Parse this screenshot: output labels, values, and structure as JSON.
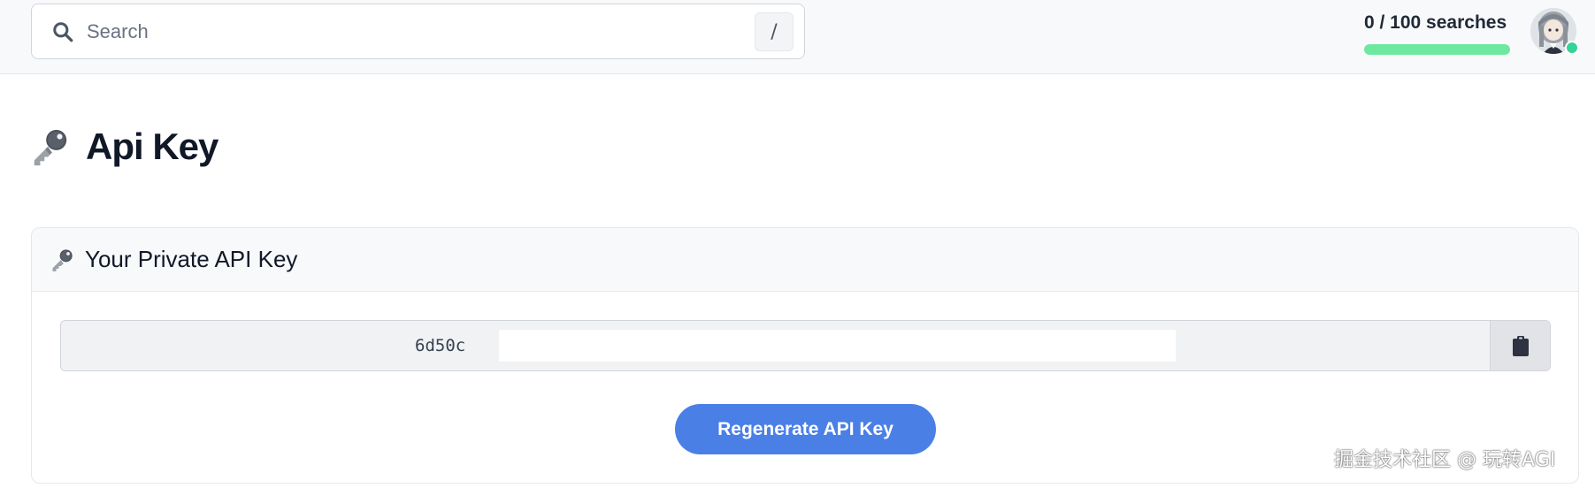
{
  "header": {
    "search": {
      "placeholder": "Search",
      "value": "",
      "shortcut": "/",
      "icon": "search-icon"
    },
    "usage": {
      "text": "0 / 100 searches",
      "used": 0,
      "limit": 100,
      "bar_color": "#6ee7a0"
    },
    "avatar": {
      "icon": "avatar",
      "status_color": "#34d399"
    }
  },
  "page": {
    "title": "Api Key",
    "icon": "key-icon"
  },
  "card": {
    "title": "Your Private API Key",
    "icon": "key-icon",
    "api_key_visible": "6d50c",
    "copy_icon": "clipboard-icon",
    "regenerate_label": "Regenerate API Key",
    "accent_color": "#4a7fe6"
  },
  "watermark": "掘金技术社区 @ 玩转AGI"
}
